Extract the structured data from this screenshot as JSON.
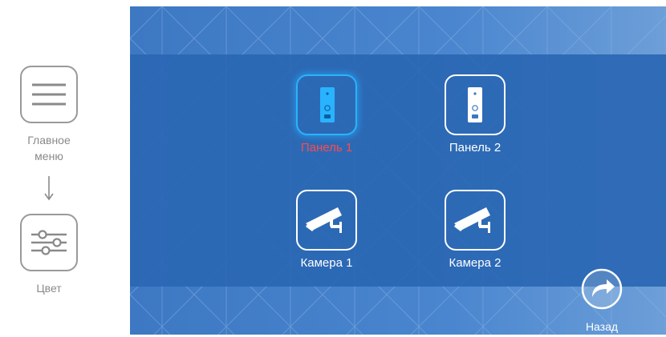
{
  "help": {
    "main_menu_label_line1": "Главное",
    "main_menu_label_line2": "меню",
    "color_label": "Цвет",
    "main_menu_icon": "hamburger-menu-icon",
    "color_icon": "sliders-icon"
  },
  "screen": {
    "items": [
      {
        "label": "Панель 1",
        "icon": "door-panel-icon",
        "selected": true
      },
      {
        "label": "Панель 2",
        "icon": "door-panel-icon",
        "selected": false
      },
      {
        "label": "Камера 1",
        "icon": "cctv-camera-icon",
        "selected": false
      },
      {
        "label": "Камера 2",
        "icon": "cctv-camera-icon",
        "selected": false
      }
    ],
    "back_label": "Назад",
    "back_icon": "forward-arrow-icon"
  },
  "colors": {
    "background": "#3a78c4",
    "band": "#2e6db9",
    "selected_border": "#29b3ff",
    "selected_text": "#ff4b4b",
    "text": "#ffffff",
    "help_gray": "#9a9a9a"
  }
}
